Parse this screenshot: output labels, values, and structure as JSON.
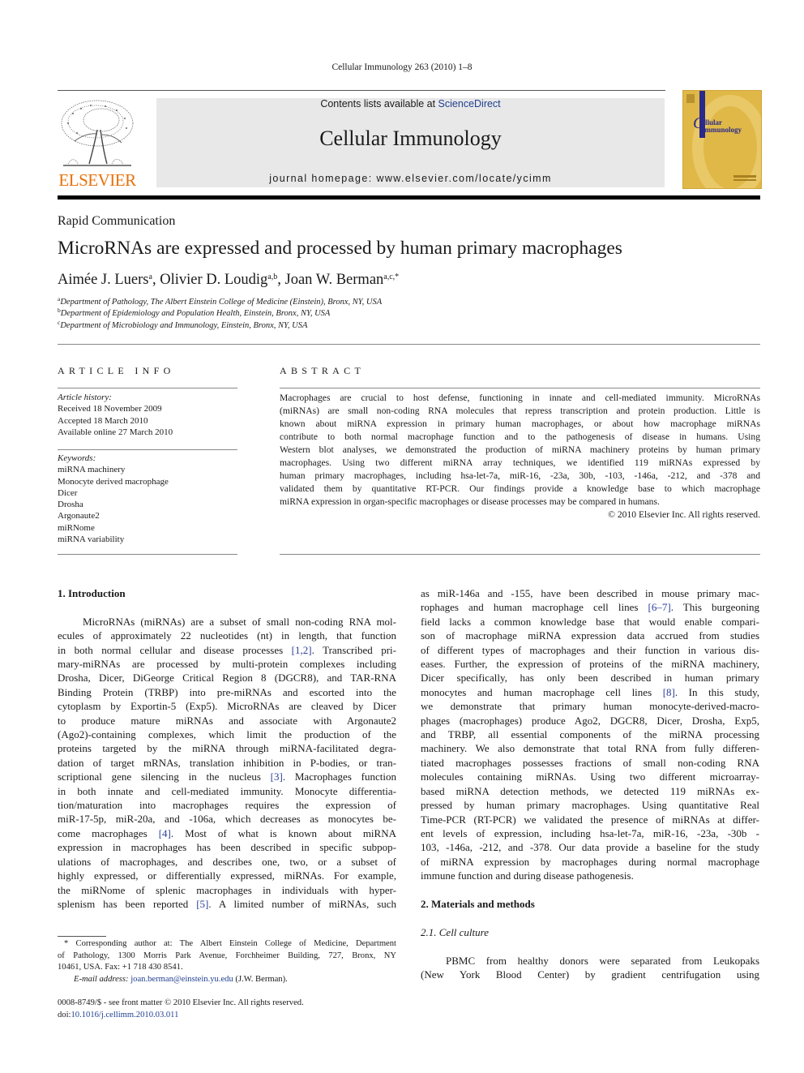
{
  "header": {
    "running_head": "Cellular Immunology 263 (2010) 1–8",
    "publisher_logo_text": "ELSEVIER",
    "contents_prefix": "Contents lists available at ",
    "contents_link": "ScienceDirect",
    "journal_name": "Cellular Immunology",
    "homepage": "journal homepage: www.elsevier.com/locate/ycimm",
    "cover": {
      "title_line1": "ellular",
      "title_initial": "C",
      "title_line2": "Immunology",
      "bg_color": "#e0b848",
      "stripe_color": "#2a2a8a"
    },
    "brand_color": "#e8710a"
  },
  "article": {
    "type": "Rapid Communication",
    "title": "MicroRNAs are expressed and processed by human primary macrophages",
    "authors": [
      {
        "name": "Aimée J. Luers",
        "sup": "a",
        "sep": ", "
      },
      {
        "name": "Olivier D. Loudig",
        "sup": "a,b",
        "sep": ", "
      },
      {
        "name": "Joan W. Berman",
        "sup": "a,c,*",
        "sep": ""
      }
    ],
    "affiliations": [
      {
        "key": "a",
        "text": "Department of Pathology, The Albert Einstein College of Medicine (Einstein), Bronx, NY, USA"
      },
      {
        "key": "b",
        "text": "Department of Epidemiology and Population Health, Einstein, Bronx, NY, USA"
      },
      {
        "key": "c",
        "text": "Department of Microbiology and Immunology, Einstein, Bronx, NY, USA"
      }
    ]
  },
  "article_info": {
    "heading": "ARTICLE INFO",
    "history_label": "Article history:",
    "history": [
      "Received 18 November 2009",
      "Accepted 18 March 2010",
      "Available online 27 March 2010"
    ],
    "keywords_label": "Keywords:",
    "keywords": [
      "miRNA machinery",
      "Monocyte derived macrophage",
      "Dicer",
      "Drosha",
      "Argonaute2",
      "miRNome",
      "miRNA variability"
    ]
  },
  "abstract": {
    "heading": "ABSTRACT",
    "lines": [
      "Macrophages are crucial to host defense, functioning in innate and cell-mediated immunity. MicroRNAs",
      "(miRNAs) are small non-coding RNA molecules that repress transcription and protein production. Little is",
      "known about miRNA expression in primary human macrophages, or about how macrophage miRNAs",
      "contribute to both normal macrophage function and to the pathogenesis of disease in humans. Using",
      "Western blot analyses, we demonstrated the production of miRNA machinery proteins by human primary",
      "macrophages. Using two different miRNA array techniques, we identified 119 miRNAs expressed by",
      "human primary macrophages, including hsa-let-7a, miR-16, -23a, 30b, -103, -146a, -212, and -378 and",
      "validated them by quantitative RT-PCR. Our findings provide a knowledge base to which macrophage",
      "miRNA expression in organ-specific macrophages or disease processes may be compared in humans."
    ],
    "copyright": "© 2010 Elsevier Inc. All rights reserved."
  },
  "body": {
    "intro_heading": "1. Introduction",
    "left_lines": [
      {
        "t": "MicroRNAs (miRNAs) are a subset of small non-coding RNA mol-"
      },
      {
        "t": "ecules of approximately 22 nucleotides (nt) in length, that function"
      },
      {
        "pre": "in both normal cellular and disease processes ",
        "cite": "[1,2]",
        "post": ". Transcribed pri-"
      },
      {
        "t": "mary-miRNAs are processed by multi-protein complexes including"
      },
      {
        "t": "Drosha, Dicer, DiGeorge Critical Region 8 (DGCR8), and TAR-RNA"
      },
      {
        "t": "Binding Protein (TRBP) into pre-miRNAs and escorted into the"
      },
      {
        "t": "cytoplasm by Exportin-5 (Exp5). MicroRNAs are cleaved by Dicer"
      },
      {
        "t": "to produce mature miRNAs and associate with Argonaute2"
      },
      {
        "t": "(Ago2)-containing complexes, which limit the production of the"
      },
      {
        "t": "proteins targeted by the miRNA through miRNA-facilitated degra-"
      },
      {
        "t": "dation of target mRNAs, translation inhibition in P-bodies, or tran-"
      },
      {
        "pre": "scriptional gene silencing in the nucleus ",
        "cite": "[3]",
        "post": ". Macrophages function"
      },
      {
        "t": "in both innate and cell-mediated immunity. Monocyte differentia-"
      },
      {
        "t": "tion/maturation into macrophages requires the expression of"
      },
      {
        "t": "miR-17-5p, miR-20a, and -106a, which decreases as monocytes be-"
      },
      {
        "pre": "come macrophages ",
        "cite": "[4]",
        "post": ". Most of what is known about miRNA"
      },
      {
        "t": "expression in macrophages has been described in specific subpop-"
      },
      {
        "t": "ulations of macrophages, and describes one, two, or a subset of"
      },
      {
        "t": "highly expressed, or differentially expressed, miRNAs. For example,"
      },
      {
        "t": "the miRNome of splenic macrophages in individuals with hyper-"
      },
      {
        "pre": "splenism has been reported ",
        "cite": "[5]",
        "post": ". A limited number of miRNAs, such"
      }
    ],
    "right_lines": [
      {
        "t": "as miR-146a and -155, have been described in mouse primary mac-"
      },
      {
        "pre": "rophages and human macrophage cell lines ",
        "cite": "[6–7]",
        "post": ". This burgeoning"
      },
      {
        "t": "field lacks a common knowledge base that would enable compari-"
      },
      {
        "t": "son of macrophage miRNA expression data accrued from studies"
      },
      {
        "t": "of different types of macrophages and their function in various dis-"
      },
      {
        "t": "eases. Further, the expression of proteins of the miRNA machinery,"
      },
      {
        "t": "Dicer specifically, has only been described in human primary"
      },
      {
        "pre": "monocytes and human macrophage cell lines ",
        "cite": "[8]",
        "post": ". In this study,"
      },
      {
        "t": "we demonstrate that primary human monocyte-derived-macro-"
      },
      {
        "t": "phages (macrophages) produce Ago2, DGCR8, Dicer, Drosha, Exp5,"
      },
      {
        "t": "and TRBP, all essential components of the miRNA processing"
      },
      {
        "t": "machinery. We also demonstrate that total RNA from fully differen-"
      },
      {
        "t": "tiated macrophages possesses fractions of small non-coding RNA"
      },
      {
        "t": "molecules containing miRNAs. Using two different microarray-"
      },
      {
        "t": "based miRNA detection methods, we detected 119 miRNAs ex-"
      },
      {
        "t": "pressed by human primary macrophages. Using quantitative Real"
      },
      {
        "t": "Time-PCR (RT-PCR) we validated the presence of miRNAs at differ-"
      },
      {
        "t": "ent levels of expression, including hsa-let-7a, miR-16, -23a, -30b -"
      },
      {
        "t": "103, -146a, -212, and -378. Our data provide a baseline for the study"
      },
      {
        "t": "of miRNA expression by macrophages during normal macrophage"
      },
      {
        "t": "immune function and during disease pathogenesis."
      }
    ],
    "methods_heading": "2. Materials and methods",
    "cell_culture_heading": "2.1. Cell culture",
    "methods_lines": [
      "PBMC from healthy donors were separated from Leukopaks",
      "(New York Blood Center) by gradient centrifugation using"
    ]
  },
  "footnotes": {
    "corresponding_lines": [
      "* Corresponding author at: The Albert Einstein College of Medicine, Department",
      "of Pathology, 1300 Morris Park Avenue, Forchheimer Building, 727, Bronx, NY",
      "10461, USA. Fax: +1 718 430 8541."
    ],
    "email_label": "E-mail address:",
    "email": "joan.berman@einstein.yu.edu",
    "email_suffix": " (J.W. Berman).",
    "front_matter": "0008-8749/$ - see front matter © 2010 Elsevier Inc. All rights reserved.",
    "doi_label": "doi:",
    "doi": "10.1016/j.cellimm.2010.03.011"
  }
}
